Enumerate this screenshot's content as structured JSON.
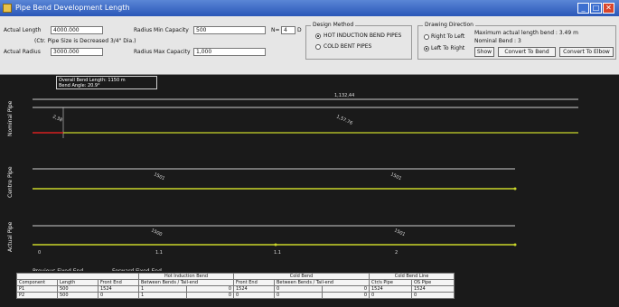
{
  "window": {
    "title": "Pipe Bend Development Length"
  },
  "inputs": {
    "actual_length_label": "Actual Length",
    "actual_length_value": "4000.000",
    "pipe_size_note": "(Ctr. Pipe Size is Decreased 3/4\" Dia.)",
    "actual_radius_label": "Actual Radius",
    "actual_radius_value": "3000.000",
    "radius_min_label": "Radius Min Capacity",
    "radius_min_value": "500",
    "radius_max_label": "Radius Max Capacity",
    "radius_max_value": "1,000",
    "n_label": "N=",
    "n_value": "4",
    "d_label": "D"
  },
  "design_method": {
    "title": "Design Method",
    "options": [
      "HOT INDUCTION BEND PIPES",
      "COLD BENT PIPES"
    ],
    "selected": 0
  },
  "drawing_direction": {
    "title": "Drawing Direction",
    "options": [
      "Right To Left",
      "Left To Right"
    ],
    "selected": 1,
    "max_length_text": "Maximum actual length bend : 3.49 m",
    "nominal_bend_text": "Nominal Bend : 3",
    "show_label": "Show",
    "convert_bend_label": "Convert To Bend",
    "convert_elbow_label": "Convert To Elbow"
  },
  "info_box": {
    "line1": "Overall Bend Length: 1150 m",
    "line2": "Bend Angle: 20.9°"
  },
  "sections": [
    {
      "label": "Nominal Pipe",
      "dim": "1,132,44",
      "a": "2,38",
      "b": "1,57.76"
    },
    {
      "label": "Centre Pipe",
      "dim": "",
      "a": "1501",
      "b": "1501"
    },
    {
      "label": "Actual Pipe",
      "dim": "",
      "a": "1500",
      "b": "1501"
    }
  ],
  "axis_marks": [
    "0",
    "1.1",
    "1.1",
    "2"
  ],
  "legend": {
    "left": "Previous Fixed End",
    "right": "Forward Fixed End"
  },
  "table": {
    "group_headers": [
      "Hot Induction Bend",
      "Cold Bend",
      "Cold Bend Line"
    ],
    "headers": [
      "Component",
      "Length",
      "Front End",
      "Between Bends / Tail-end",
      "Front End",
      "Between Bends / Tail-end",
      "Ctr/s Pipe",
      "OS Pipe"
    ],
    "rows": [
      [
        "P1",
        "500",
        "1524",
        "1",
        "0",
        "1524",
        "0",
        "0",
        "1524",
        "1524"
      ],
      [
        "P2",
        "500",
        "0",
        "1",
        "0",
        "0",
        "0",
        "0",
        "0",
        "0"
      ]
    ]
  },
  "colors": {
    "chart_bg": "#1a1a1a",
    "pipe_line": "#c9d62a",
    "grid_line": "#cfcfcf",
    "fixed_end": "#d81f1f",
    "title_bar": "#3b6fd1"
  }
}
